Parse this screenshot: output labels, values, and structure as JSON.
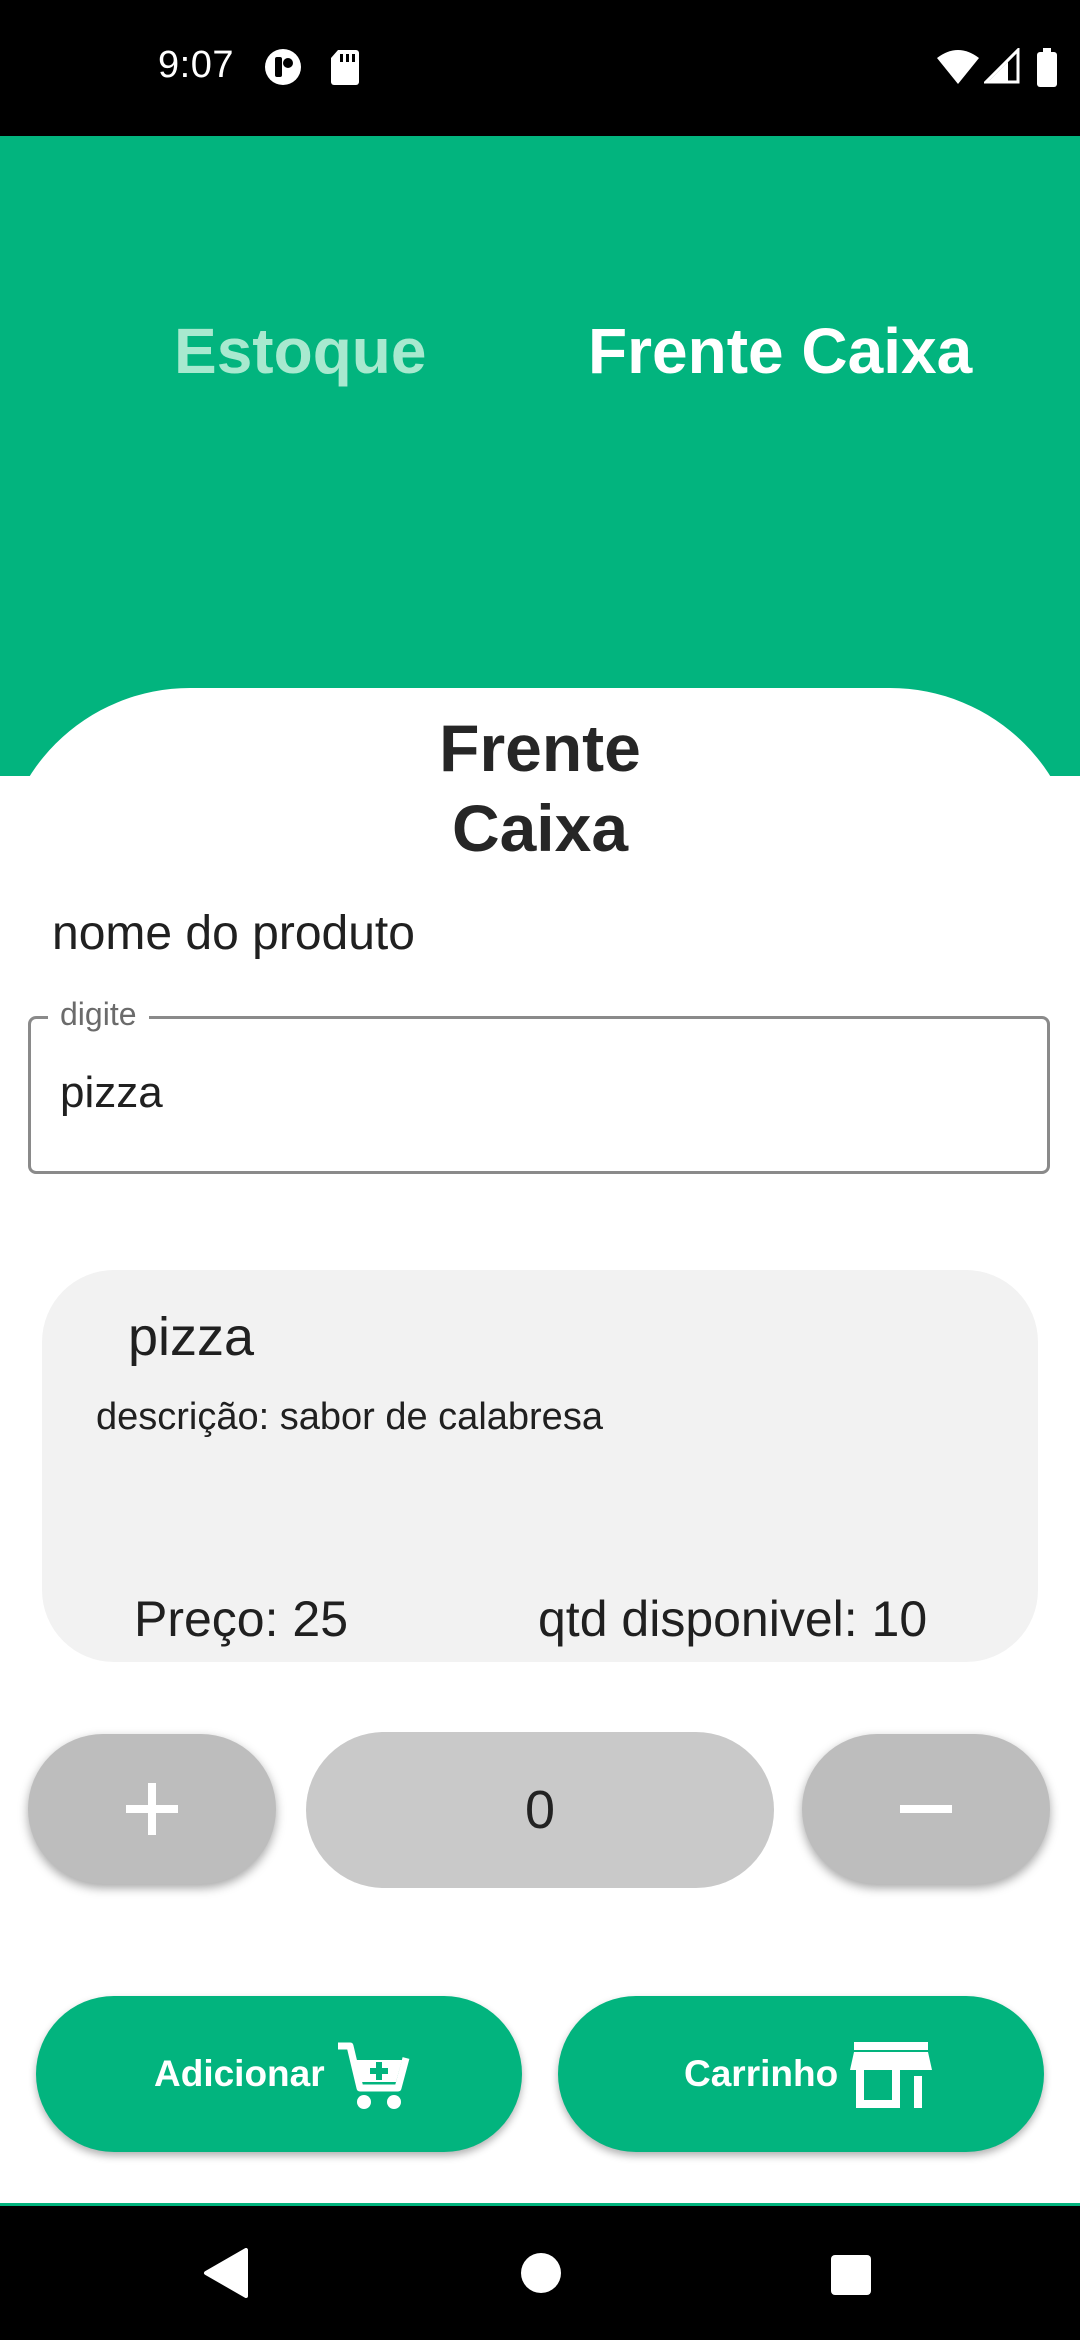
{
  "status_bar": {
    "time": "9:07",
    "icons": [
      "notification-icon",
      "sd-card-icon",
      "wifi-icon",
      "cell-signal-icon",
      "battery-icon"
    ]
  },
  "header": {
    "tabs": [
      {
        "label": "Estoque",
        "active": false
      },
      {
        "label": "Frente Caixa",
        "active": true
      }
    ],
    "color": "#02b47e"
  },
  "page": {
    "title_line1": "Frente",
    "title_line2": "Caixa"
  },
  "search": {
    "label": "nome do produto",
    "legend": "digite",
    "value": "pizza"
  },
  "product": {
    "name": "pizza",
    "description": "descrição: sabor de calabresa",
    "price": "Preço: 25",
    "stock": "qtd disponivel: 10"
  },
  "quantity": {
    "value": "0",
    "increment_icon": "plus-icon",
    "decrement_icon": "minus-icon"
  },
  "actions": {
    "add_label": "Adicionar",
    "add_icon": "add-to-cart-icon",
    "cart_label": "Carrinho",
    "cart_icon": "store-icon"
  },
  "nav_bar": {
    "icons": [
      "back-icon",
      "home-icon",
      "recents-icon"
    ]
  }
}
